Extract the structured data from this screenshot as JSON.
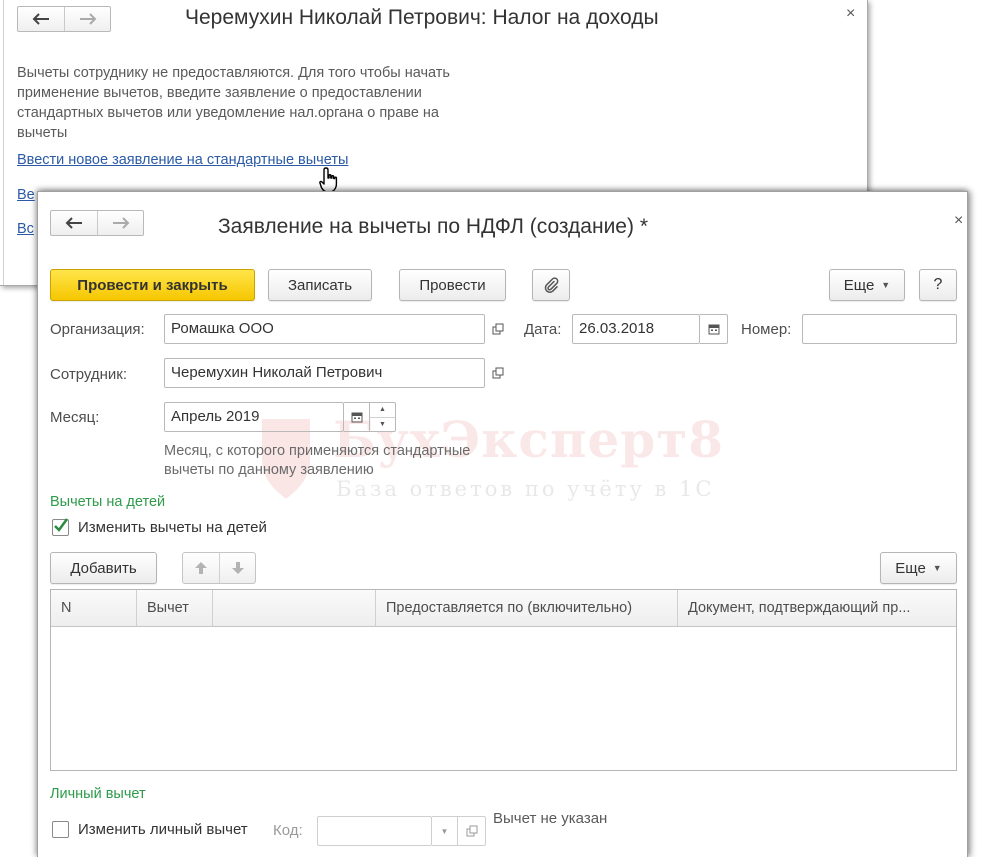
{
  "background_window": {
    "title": "Черемухин Николай Петрович: Налог на доходы",
    "close_glyph": "×",
    "description": "Вычеты сотруднику не предоставляются. Для того чтобы начать применение вычетов, введите заявление о предоставлении стандартных вычетов или уведомление нал.органа о праве на вычеты",
    "link_new_application": "Ввести новое заявление на стандартные вычеты",
    "link_truncated_1": "Ве",
    "link_truncated_2": "Вс"
  },
  "form": {
    "title": "Заявление на вычеты по НДФЛ (создание) *",
    "close_glyph": "×",
    "toolbar": {
      "post_and_close": "Провести и закрыть",
      "save": "Записать",
      "post": "Провести",
      "more": "Еще",
      "help": "?"
    },
    "organization": {
      "label": "Организация:",
      "value": "Ромашка ООО"
    },
    "date": {
      "label": "Дата:",
      "value": "26.03.2018"
    },
    "number": {
      "label": "Номер:",
      "value": ""
    },
    "employee": {
      "label": "Сотрудник:",
      "value": "Черемухин Николай Петрович"
    },
    "month": {
      "label": "Месяц:",
      "value": "Апрель 2019",
      "hint": "Месяц, с которого применяются стандартные вычеты по данному заявлению"
    },
    "children_section": {
      "title": "Вычеты на детей",
      "change_checkbox_label": "Изменить вычеты на детей",
      "change_checked": true,
      "add_button": "Добавить",
      "more": "Еще",
      "columns": [
        "N",
        "Вычет",
        "",
        "Предоставляется по (включительно)",
        "Документ, подтверждающий пр..."
      ]
    },
    "personal_section": {
      "title": "Личный вычет",
      "change_checkbox_label": "Изменить личный вычет",
      "change_checked": false,
      "code_label": "Код:",
      "code_value": "",
      "status": "Вычет не указан"
    }
  },
  "watermark": {
    "text": "БухЭксперт8",
    "subtitle": "База ответов по учёту в 1С"
  },
  "colors": {
    "primary_button": "#f6c700",
    "section_title": "#2d9b4a",
    "link": "#2b5aa6"
  }
}
